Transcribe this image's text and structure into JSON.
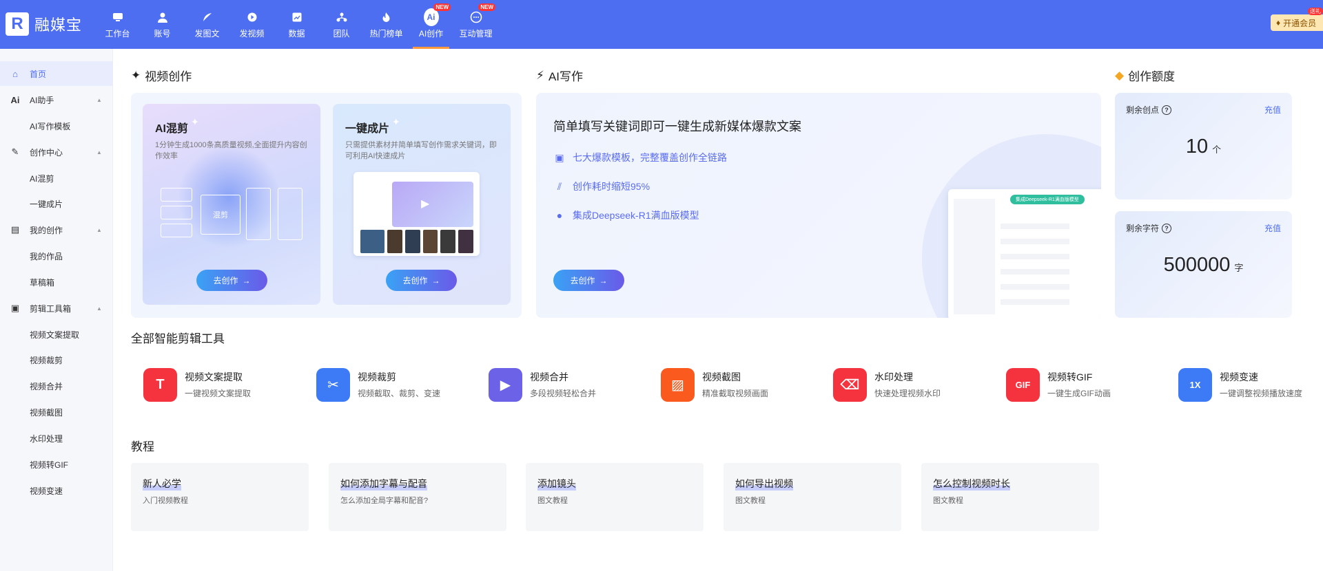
{
  "header": {
    "logo_text": "融媒宝",
    "nav": [
      {
        "label": "工作台",
        "icon": "monitor-icon"
      },
      {
        "label": "账号",
        "icon": "user-icon"
      },
      {
        "label": "发图文",
        "icon": "feather-icon"
      },
      {
        "label": "发视频",
        "icon": "play-icon"
      },
      {
        "label": "数据",
        "icon": "chart-icon"
      },
      {
        "label": "团队",
        "icon": "team-icon"
      },
      {
        "label": "热门榜单",
        "icon": "fire-icon"
      },
      {
        "label": "AI创作",
        "icon": "ai-icon",
        "badge": "NEW",
        "active": true
      },
      {
        "label": "互动管理",
        "icon": "chat-icon",
        "badge": "NEW"
      }
    ],
    "ai_icon_text": "Ai",
    "vip_label": "开通会员",
    "vip_tag": "送礼"
  },
  "sidebar": {
    "items": [
      {
        "label": "首页",
        "icon": "home-icon",
        "glyph": "⌂",
        "active": true
      },
      {
        "label": "AI助手",
        "icon": "ai-assistant-icon",
        "glyph": "Ai",
        "expandable": true
      },
      {
        "label": "AI写作模板"
      },
      {
        "label": "创作中心",
        "icon": "pen-icon",
        "glyph": "✎",
        "expandable": true
      },
      {
        "label": "AI混剪"
      },
      {
        "label": "一键成片"
      },
      {
        "label": "我的创作",
        "icon": "book-icon",
        "glyph": "▤",
        "expandable": true
      },
      {
        "label": "我的作品"
      },
      {
        "label": "草稿箱"
      },
      {
        "label": "剪辑工具箱",
        "icon": "toolbox-icon",
        "glyph": "▣",
        "expandable": true
      },
      {
        "label": "视频文案提取"
      },
      {
        "label": "视频裁剪"
      },
      {
        "label": "视频合并"
      },
      {
        "label": "视频截图"
      },
      {
        "label": "水印处理"
      },
      {
        "label": "视频转GIF"
      },
      {
        "label": "视频变速"
      }
    ]
  },
  "video_creation": {
    "title": "视频创作",
    "cards": [
      {
        "title": "AI混剪",
        "desc": "1分钟生成1000条高质量视频,全面提升内容创作效率",
        "button": "去创作",
        "preview_text": "混剪"
      },
      {
        "title": "一键成片",
        "desc": "只需提供素材并简单填写创作需求关键词，即可利用AI快速成片",
        "button": "去创作"
      }
    ]
  },
  "ai_writing": {
    "title": "AI写作",
    "headline": "简单填写关键词即可一键生成新媒体爆款文案",
    "features": [
      {
        "text": "七大爆款模板，完整覆盖创作全链路",
        "icon": "template-icon"
      },
      {
        "text": "创作耗时缩短95%",
        "icon": "speed-icon"
      },
      {
        "text": "集成Deepseek-R1满血版模型",
        "icon": "bulb-icon"
      }
    ],
    "button": "去创作",
    "preview_pill": "集成Deepseek-R1满血版模型"
  },
  "quota": {
    "title": "创作额度",
    "items": [
      {
        "label": "剩余创点",
        "value": "10",
        "unit": "个",
        "action": "充值"
      },
      {
        "label": "剩余字符",
        "value": "500000",
        "unit": "字",
        "action": "充值"
      }
    ]
  },
  "tools": {
    "title": "全部智能剪辑工具",
    "items": [
      {
        "name": "视频文案提取",
        "desc": "一键视频文案提取",
        "icon": "text-extract-icon",
        "glyph": "T",
        "color": "#f5333f"
      },
      {
        "name": "视频裁剪",
        "desc": "视频截取、裁剪、变速",
        "icon": "scissors-icon",
        "glyph": "✂",
        "color": "#3d7af5"
      },
      {
        "name": "视频合并",
        "desc": "多段视频轻松合并",
        "icon": "merge-icon",
        "glyph": "▶",
        "color": "#6b62e8"
      },
      {
        "name": "视频截图",
        "desc": "精准截取视频画面",
        "icon": "screenshot-icon",
        "glyph": "▨",
        "color": "#fa5a1e"
      },
      {
        "name": "水印处理",
        "desc": "快速处理视频水印",
        "icon": "eraser-icon",
        "glyph": "⌫",
        "color": "#f5333f"
      },
      {
        "name": "视频转GIF",
        "desc": "一键生成GIF动画",
        "icon": "gif-icon",
        "glyph": "GIF",
        "color": "#f5333f"
      },
      {
        "name": "视频变速",
        "desc": "一键调整视频播放速度",
        "icon": "speed-change-icon",
        "glyph": "1X",
        "color": "#3d7af5"
      }
    ]
  },
  "tutorials": {
    "title": "教程",
    "items": [
      {
        "title": "新人必学",
        "desc": "入门视频教程"
      },
      {
        "title": "如何添加字幕与配音",
        "desc": "怎么添加全局字幕和配音?"
      },
      {
        "title": "添加镜头",
        "desc": "图文教程"
      },
      {
        "title": "如何导出视频",
        "desc": "图文教程"
      },
      {
        "title": "怎么控制视频时长",
        "desc": "图文教程"
      }
    ]
  }
}
